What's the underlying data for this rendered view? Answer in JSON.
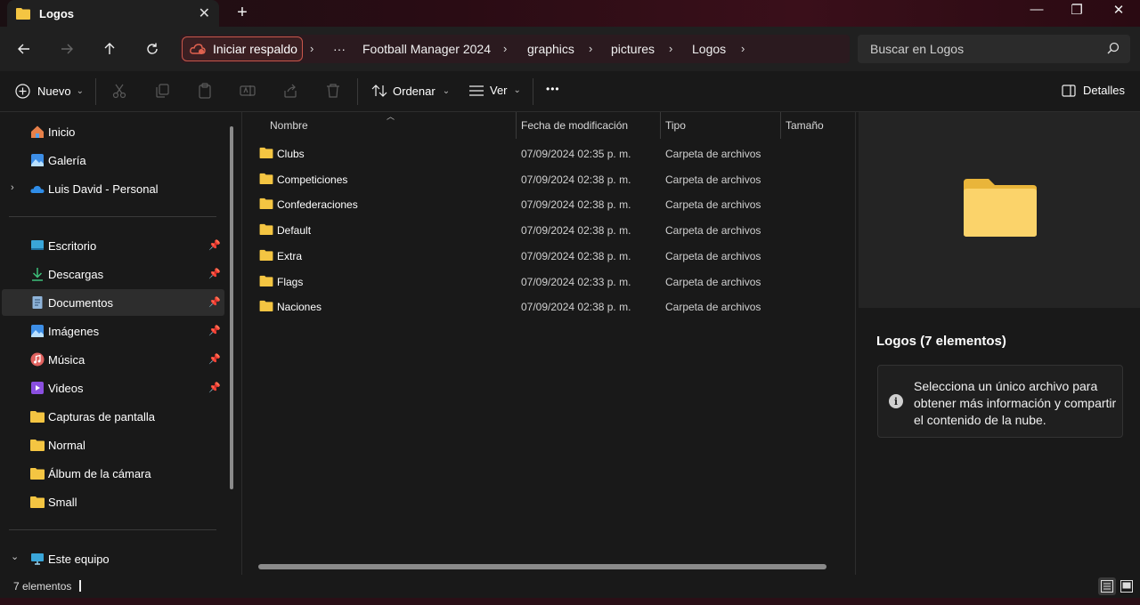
{
  "window": {
    "tab_title": "Logos",
    "new_tab_symbol": "+",
    "minimize_symbol": "—",
    "maximize_symbol": "❐",
    "close_symbol": "✕",
    "tab_close_symbol": "✕"
  },
  "address_bar": {
    "backup_label": "Iniciar respaldo",
    "overflow_symbol": "···",
    "separator_symbol": "›",
    "breadcrumbs": [
      "Football Manager 2024",
      "graphics",
      "pictures",
      "Logos"
    ],
    "search_placeholder": "Buscar en Logos"
  },
  "command_bar": {
    "new_label": "Nuevo",
    "sort_label": "Ordenar",
    "view_label": "Ver",
    "more_symbol": "•••",
    "details_label": "Detalles",
    "dropdown_symbol": "⌄"
  },
  "sidebar": {
    "quick": [
      {
        "label": "Inicio",
        "icon": "home-icon"
      },
      {
        "label": "Galería",
        "icon": "gallery-icon"
      },
      {
        "label": "Luis David - Personal",
        "icon": "onedrive-icon",
        "expandable": true
      }
    ],
    "pinned": [
      {
        "label": "Escritorio",
        "icon": "desktop-icon",
        "pinned": true
      },
      {
        "label": "Descargas",
        "icon": "downloads-icon",
        "pinned": true
      },
      {
        "label": "Documentos",
        "icon": "documents-icon",
        "pinned": true,
        "selected": true
      },
      {
        "label": "Imágenes",
        "icon": "pictures-icon",
        "pinned": true
      },
      {
        "label": "Música",
        "icon": "music-icon",
        "pinned": true
      },
      {
        "label": "Videos",
        "icon": "videos-icon",
        "pinned": true
      },
      {
        "label": "Capturas de pantalla",
        "icon": "folder-icon"
      },
      {
        "label": "Normal",
        "icon": "folder-icon"
      },
      {
        "label": "Álbum de la cámara",
        "icon": "folder-icon"
      },
      {
        "label": "Small",
        "icon": "folder-icon"
      }
    ],
    "this_pc": {
      "label": "Este equipo",
      "icon": "pc-icon",
      "expanded": true
    },
    "pin_symbol": "📌",
    "expand_symbol": "›",
    "collapse_symbol": "⌄"
  },
  "file_list": {
    "columns": {
      "name": "Nombre",
      "modified": "Fecha de modificación",
      "type": "Tipo",
      "size": "Tamaño"
    },
    "sort_indicator": "︿",
    "rows": [
      {
        "name": "Clubs",
        "modified": "07/09/2024 02:35 p. m.",
        "type": "Carpeta de archivos"
      },
      {
        "name": "Competiciones",
        "modified": "07/09/2024 02:38 p. m.",
        "type": "Carpeta de archivos"
      },
      {
        "name": "Confederaciones",
        "modified": "07/09/2024 02:38 p. m.",
        "type": "Carpeta de archivos"
      },
      {
        "name": "Default",
        "modified": "07/09/2024 02:38 p. m.",
        "type": "Carpeta de archivos"
      },
      {
        "name": "Extra",
        "modified": "07/09/2024 02:38 p. m.",
        "type": "Carpeta de archivos"
      },
      {
        "name": "Flags",
        "modified": "07/09/2024 02:33 p. m.",
        "type": "Carpeta de archivos"
      },
      {
        "name": "Naciones",
        "modified": "07/09/2024 02:38 p. m.",
        "type": "Carpeta de archivos"
      }
    ]
  },
  "details_pane": {
    "title": "Logos (7 elementos)",
    "info_symbol": "i",
    "message": "Selecciona un único archivo para obtener más información y compartir el contenido de la nube."
  },
  "status_bar": {
    "item_count": "7 elementos"
  },
  "colors": {
    "folder": "#f4c542",
    "backup_accent": "#e0624f",
    "selection": "#2d2d2d"
  }
}
